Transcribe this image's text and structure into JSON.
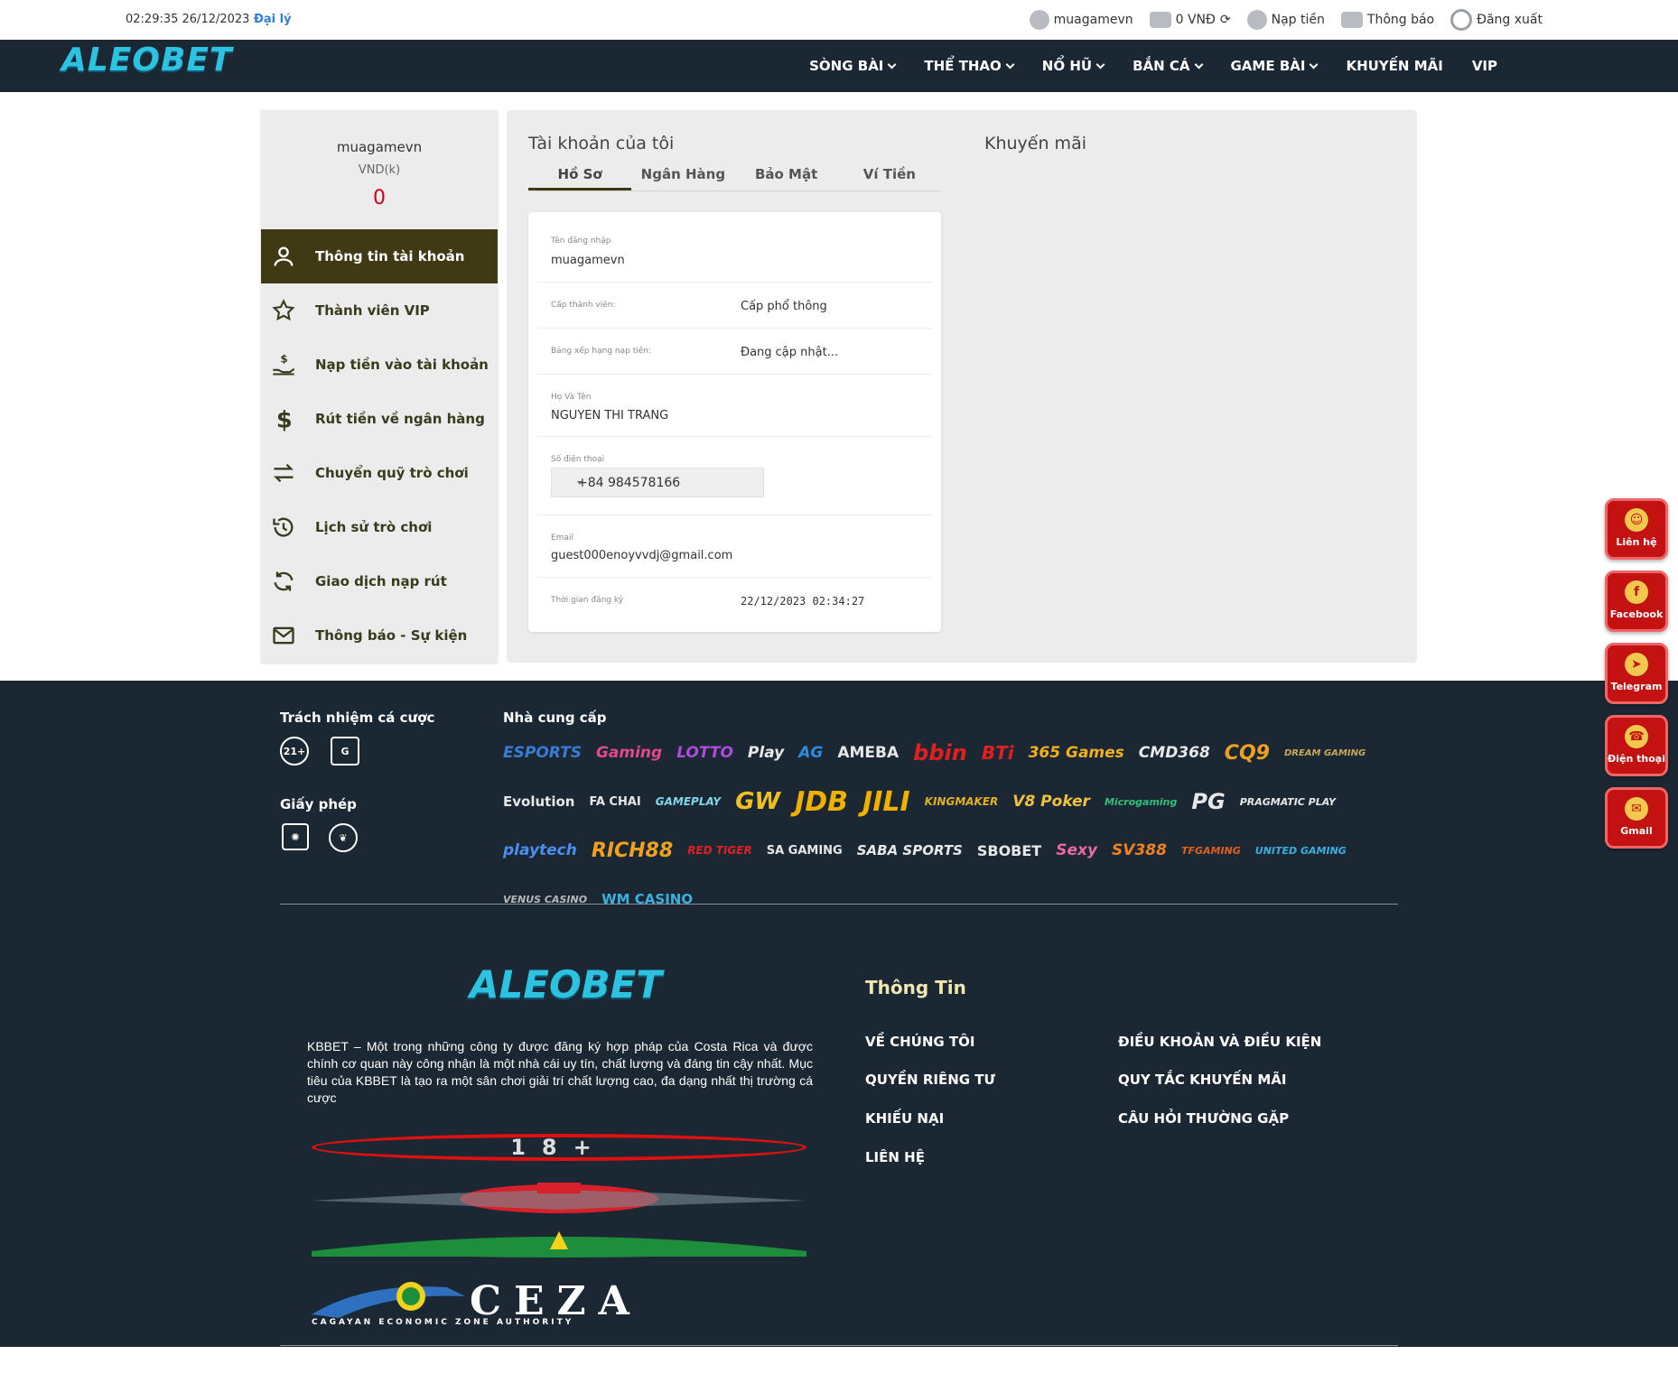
{
  "topbar": {
    "datetime": "02:29:35 26/12/2023",
    "agent": "Đại lý",
    "username": "muagamevn",
    "balance": "0 VNĐ",
    "deposit": "Nạp tiền",
    "notify": "Thông báo",
    "logout": "Đăng xuất"
  },
  "nav": {
    "logo": "ALEOBET",
    "items": [
      "SÒNG BÀI",
      "THỂ THAO",
      "NỔ HŨ",
      "BẮN CÁ",
      "GAME BÀI",
      "KHUYẾN MÃI",
      "VIP"
    ]
  },
  "sidebar": {
    "username": "muagamevn",
    "currency": "VND(k)",
    "balance": "0",
    "menu": [
      "Thông tin tài khoản",
      "Thành viên VIP",
      "Nạp tiền vào tài khoản",
      "Rút tiền về ngân hàng",
      "Chuyển quỹ trò chơi",
      "Lịch sử trò chơi",
      "Giao dịch nạp rút",
      "Thông báo - Sự kiện"
    ]
  },
  "account": {
    "title": "Tài khoản của tôi",
    "promo_title": "Khuyến mãi",
    "tabs": [
      "Hồ Sơ",
      "Ngân Hàng",
      "Bảo Mật",
      "Ví Tiền"
    ],
    "fields": {
      "login_label": "Tên đăng nhập",
      "login_value": "muagamevn",
      "level_label": "Cấp thành viên:",
      "level_value": "Cấp phổ thông",
      "rank_label": "Bảng xếp hạng nạp tiền:",
      "rank_value": "Đang cập nhật...",
      "name_label": "Họ Và Tên",
      "name_value": "NGUYEN THI TRANG",
      "phone_label": "Số điện thoại",
      "phone_value": "+84 984578166",
      "email_label": "Email",
      "email_value": "guest000enoyvvdj@gmail.com",
      "reg_label": "Thời gian đăng ký",
      "reg_value": "22/12/2023 02:34:27"
    }
  },
  "footer": {
    "responsibility": "Trách nhiệm cá cược",
    "badges": [
      "21+"
    ],
    "license": "Giấy phép",
    "providers_title": "Nhà cung cấp",
    "providers": [
      "ESPORTS",
      "Gaming",
      "LOTTO",
      "Play",
      "AG",
      "AMEBA",
      "bbin",
      "BTi",
      "365 Games",
      "CMD368",
      "CQ9",
      "DREAM GAMING",
      "Evolution",
      "FA CHAI",
      "GAMEPLAY",
      "GW",
      "JDB",
      "JILI",
      "KINGMAKER",
      "V8 Poker",
      "Microgaming",
      "PG",
      "PRAGMATIC PLAY",
      "playtech",
      "RICH88",
      "RED TIGER",
      "SA GAMING",
      "SABA SPORTS",
      "SBOBET",
      "Sexy",
      "SV388",
      "TFGAMING",
      "UNITED GAMING",
      "VENUS CASINO",
      "WM CASINO"
    ],
    "logo": "ALEOBET",
    "description": "KBBET – Một trong những công ty được đăng ký hợp pháp của Costa Rica và được chính cơ quan này công nhận là một nhà cái uy tín, chất lượng và đáng tin cậy nhất. Mục tiêu của KBBET là tạo ra một sân chơi giải trí chất lượng cao, đa dạng nhất thị trường cá cược",
    "seal_18": "18+",
    "ceza": "CEZA",
    "ceza_sub": "CAGAYAN ECONOMIC ZONE AUTHORITY",
    "info_title": "Thông Tin",
    "links_left": [
      "VỀ CHÚNG TÔI",
      "QUYỀN RIÊNG TƯ",
      "KHIẾU NẠI",
      "LIÊN HỆ"
    ],
    "links_right": [
      "ĐIỀU KHOẢN VÀ ĐIỀU KIỆN",
      "QUY TẮC KHUYẾN MÃI",
      "CÂU HỎI THƯỜNG GẶP"
    ]
  },
  "contacts": [
    "Liên hệ",
    "Facebook",
    "Telegram",
    "Điện thoại",
    "Gmail"
  ],
  "colors": {
    "nav_bg": "#1b2833",
    "accent_dark": "#3f3a13",
    "balance_red": "#d0021b",
    "contact_red": "#c41212",
    "logo_cyan": "#2dc2e0"
  }
}
